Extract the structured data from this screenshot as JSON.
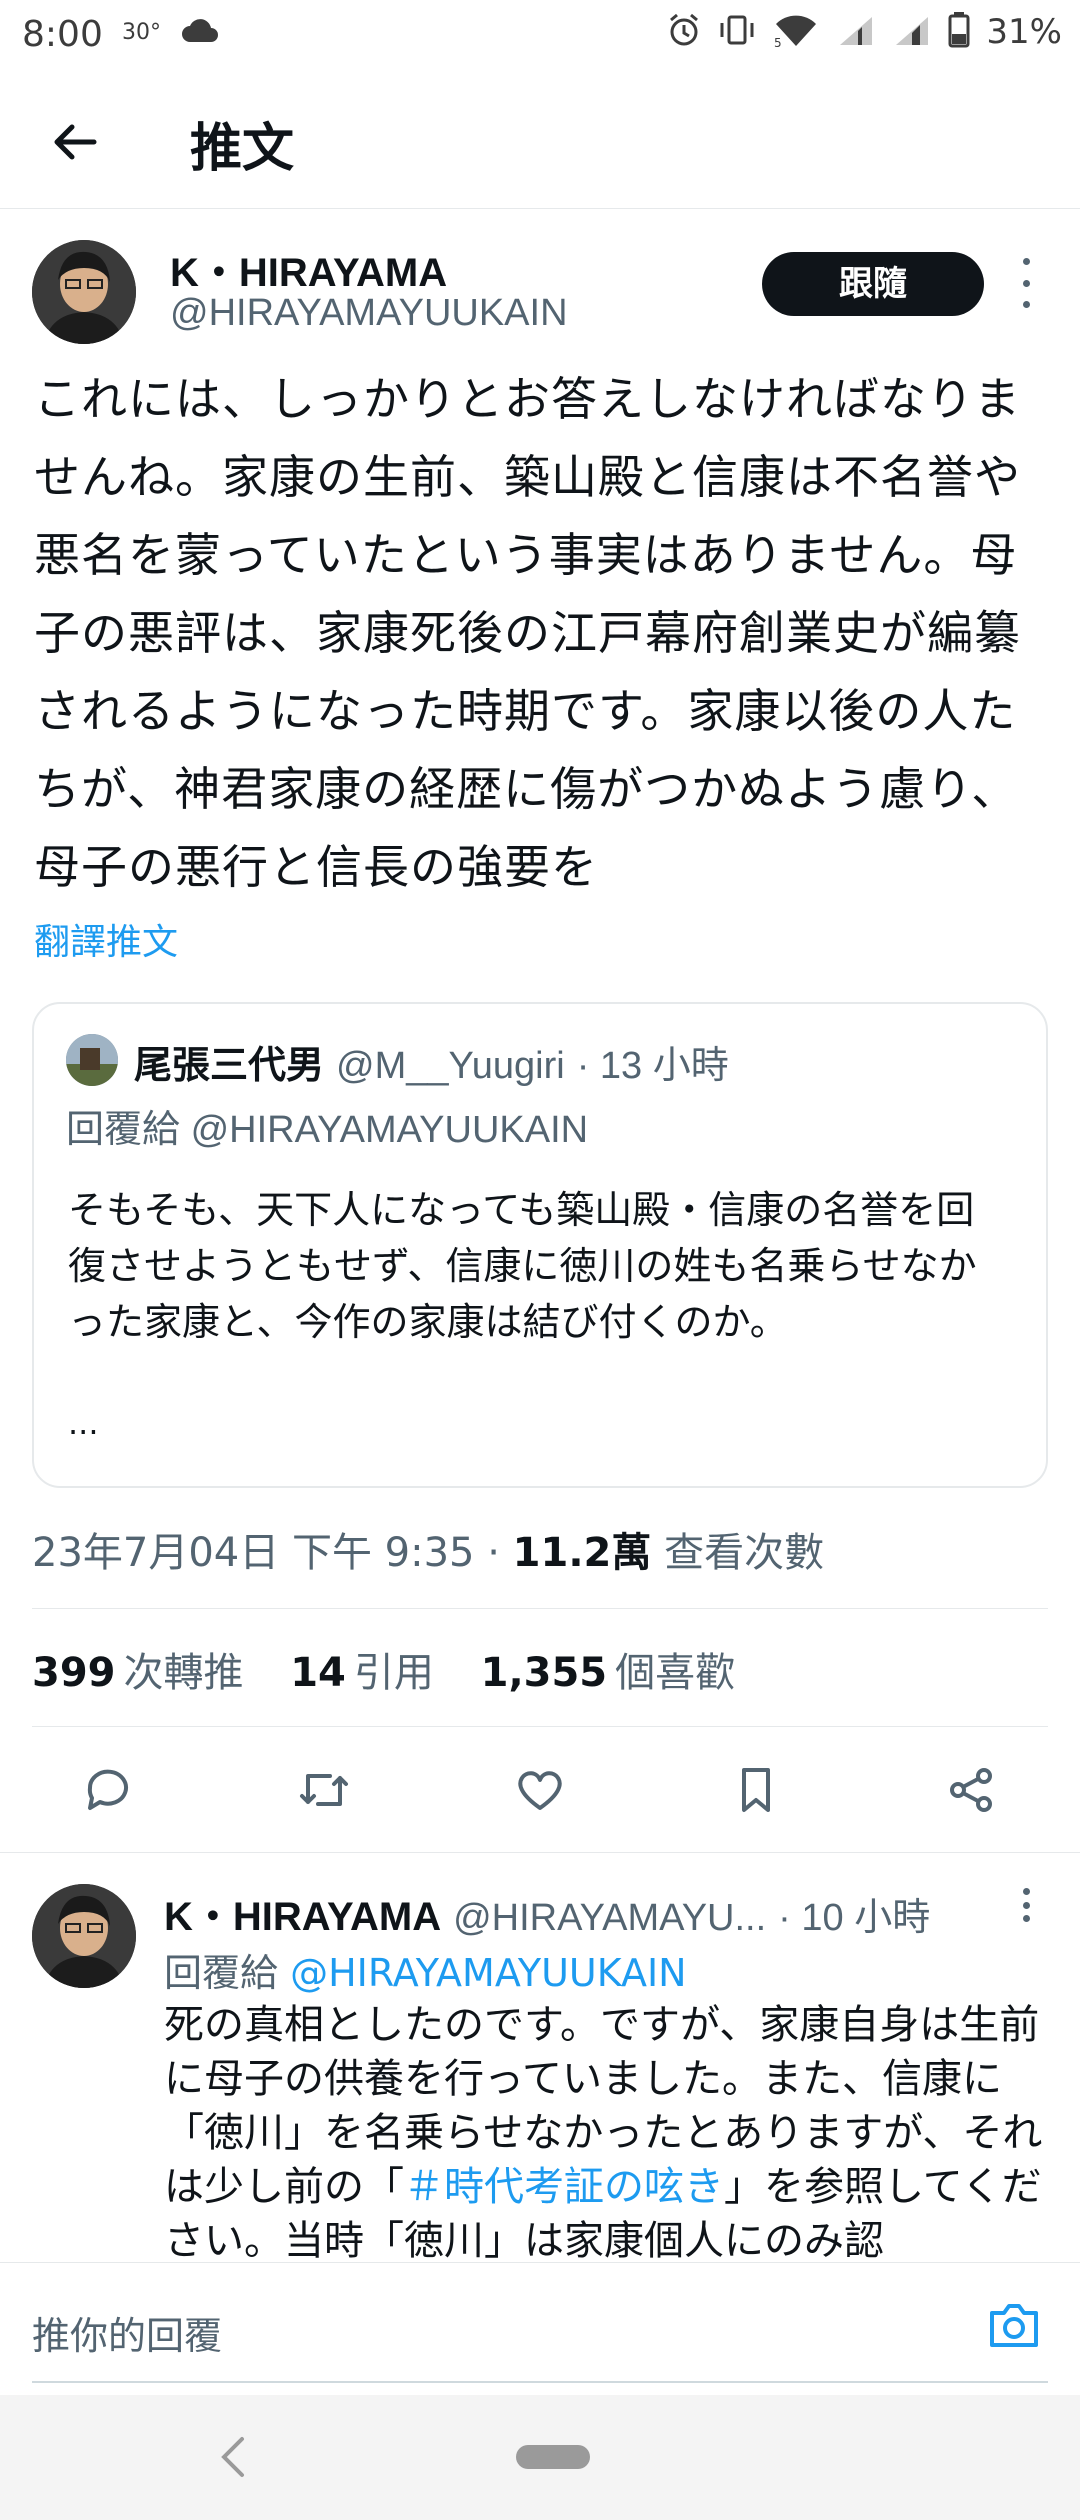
{
  "status_bar": {
    "time": "8:00",
    "temperature": "30°",
    "battery": "31%"
  },
  "header": {
    "title": "推文"
  },
  "tweet": {
    "author_name": "K・HIRAYAMA",
    "author_handle": "@HIRAYAMAYUUKAIN",
    "follow_label": "跟隨",
    "text": "これには、しっかりとお答えしなければなりませんね。家康の生前、築山殿と信康は不名誉や悪名を蒙っていたという事実はありません。母子の悪評は、家康死後の江戸幕府創業史が編纂されるようになった時期です。家康以後の人たちが、神君家康の経歴に傷がつかぬよう慮り、母子の悪行と信長の強要を",
    "translate_label": "翻譯推文",
    "quoted": {
      "author_name": "尾張三代男",
      "author_handle": "@M__Yuugiri",
      "time": "· 13 小時",
      "reply_to_label": "回覆給",
      "reply_to_handle": "@HIRAYAMAYUUKAIN",
      "text": "そもそも、天下人になっても築山殿・信康の名誉を回復させようともせず、信康に徳川の姓も名乗らせなかった家康と、今作の家康は結び付くのか。",
      "ellipsis": "..."
    },
    "timestamp": "23年7月04日 下午 9:35 ·",
    "views_count": "11.2萬",
    "views_label": "查看次數",
    "stats": {
      "retweets_count": "399",
      "retweets_label": "次轉推",
      "quotes_count": "14",
      "quotes_label": "引用",
      "likes_count": "1,355",
      "likes_label": "個喜歡"
    }
  },
  "reply": {
    "author_name": "K・HIRAYAMA",
    "author_handle": "@HIRAYAMAYU...",
    "time": "· 10 小時",
    "reply_to_label": "回覆給",
    "reply_to_handle": "@HIRAYAMAYUUKAIN",
    "text_part1": "死の真相としたのです。ですが、家康自身は生前に母子の供養を行っていました。また、信康に「徳川」を名乗らせなかったとありますが、それは少し前の「",
    "hashtag": "＃時代考証の呟き",
    "text_part2": "」を参照してください。当時「徳川」は家康個人にのみ認"
  },
  "composer": {
    "placeholder": "推你的回覆"
  },
  "colors": {
    "accent": "#1d9bf0",
    "text": "#0f1419",
    "secondary": "#536471",
    "follow_button": "#0f1419"
  }
}
